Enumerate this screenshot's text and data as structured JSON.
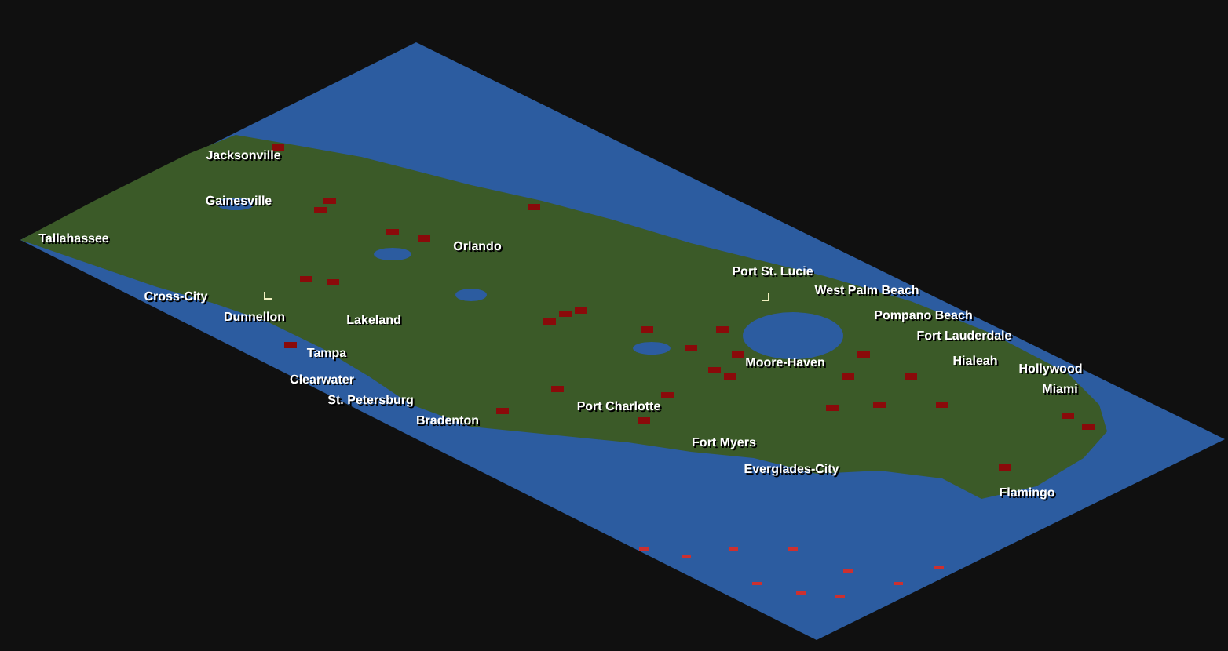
{
  "map": {
    "towns": [
      {
        "name": "Jacksonville"
      },
      {
        "name": "Gainesville"
      },
      {
        "name": "Tallahassee"
      },
      {
        "name": "Orlando"
      },
      {
        "name": "Cross-City"
      },
      {
        "name": "Dunnellon"
      },
      {
        "name": "Lakeland"
      },
      {
        "name": "Tampa"
      },
      {
        "name": "Clearwater"
      },
      {
        "name": "St. Petersburg"
      },
      {
        "name": "Bradenton"
      },
      {
        "name": "Port St. Lucie"
      },
      {
        "name": "West Palm Beach"
      },
      {
        "name": "Pompano Beach"
      },
      {
        "name": "Fort Lauderdale"
      },
      {
        "name": "Moore-Haven"
      },
      {
        "name": "Hialeah"
      },
      {
        "name": "Hollywood"
      },
      {
        "name": "Miami"
      },
      {
        "name": "Port Charlotte"
      },
      {
        "name": "Fort Myers"
      },
      {
        "name": "Everglades-City"
      },
      {
        "name": "Flamingo"
      }
    ]
  }
}
